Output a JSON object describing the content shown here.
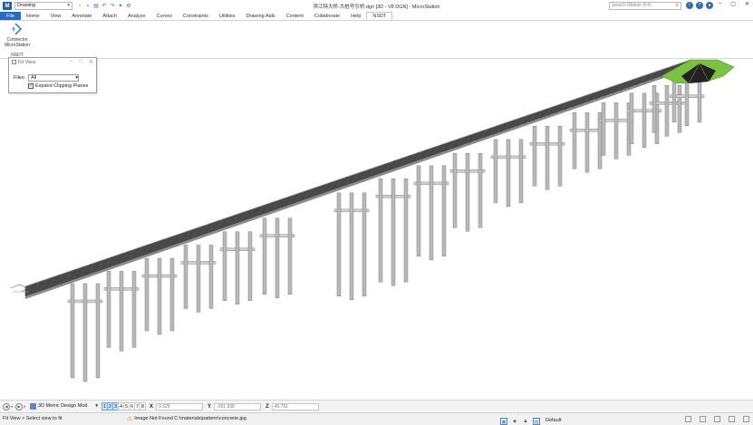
{
  "titlebar": {
    "logo_letter": "M",
    "workflow": "Drawing",
    "window_title": "滨江特大桥-大桩号引桥.dgn [3D - V8 DGN] - MicroStation",
    "search_placeholder": "Search Ribbon (F4)",
    "qat_icons": [
      "new-file-icon",
      "save-icon",
      "print-icon",
      "undo-icon",
      "redo-icon",
      "snap-icon",
      "settings-icon"
    ]
  },
  "tabs": [
    "File",
    "Home",
    "View",
    "Annotate",
    "Attach",
    "Analyze",
    "Curves",
    "Constraints",
    "Utilities",
    "Drawing Aids",
    "Content",
    "Collaborate",
    "Help",
    "NSDT"
  ],
  "active_tab": "NSDT",
  "ribbon": {
    "button_label_line1": "Connector",
    "button_label_line2": "MicroStation",
    "group_label": "NSDT"
  },
  "fit_view": {
    "title": "Fit View",
    "files_label": "Files:",
    "files_value": "All",
    "expand_label": "Expand Clipping Planes",
    "expand_checked": true
  },
  "viewbar": {
    "model": "3D Metric Design Mod",
    "views": [
      "1",
      "2",
      "3",
      "4",
      "5",
      "6",
      "7",
      "8"
    ],
    "active_views": [
      "1",
      "2",
      "3"
    ],
    "x_label": "X",
    "x_value": "9.529",
    "y_label": "Y",
    "y_value": "-261.938",
    "z_label": "Z",
    "z_value": "49.751"
  },
  "status": {
    "prompt": "Fit View > Select view to fit",
    "message": "Image Not Found C:\\materials\\pattern\\concrete.jpg",
    "level": "Default"
  },
  "colors": {
    "accent": "#1f6fc5",
    "deck": "#4a4a4a",
    "pier": "#b9b9b9",
    "terrain": "#7cc242"
  }
}
